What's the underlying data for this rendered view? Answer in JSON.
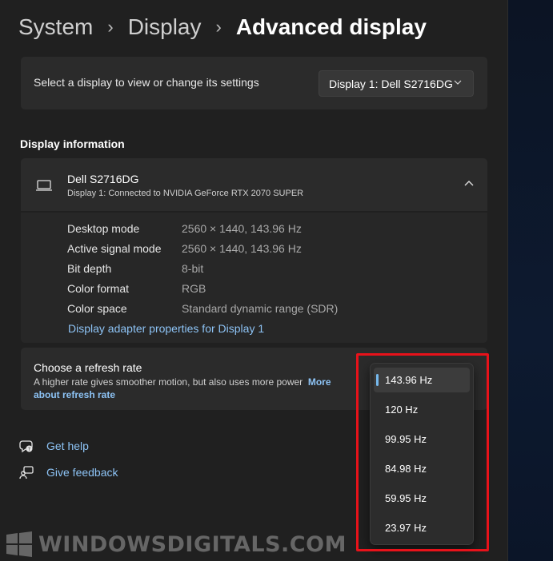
{
  "breadcrumb": {
    "items": [
      "System",
      "Display"
    ],
    "current": "Advanced display"
  },
  "display_select": {
    "label": "Select a display to view or change its settings",
    "value": "Display 1: Dell S2716DG"
  },
  "display_information": {
    "heading": "Display information",
    "monitor_name": "Dell S2716DG",
    "connection": "Display 1: Connected to NVIDIA GeForce RTX 2070 SUPER",
    "specs": [
      {
        "label": "Desktop mode",
        "value": "2560 × 1440, 143.96 Hz"
      },
      {
        "label": "Active signal mode",
        "value": "2560 × 1440, 143.96 Hz"
      },
      {
        "label": "Bit depth",
        "value": "8-bit"
      },
      {
        "label": "Color format",
        "value": "RGB"
      },
      {
        "label": "Color space",
        "value": "Standard dynamic range (SDR)"
      }
    ],
    "adapter_link": "Display adapter properties for Display 1"
  },
  "refresh_rate": {
    "title": "Choose a refresh rate",
    "description": "A higher rate gives smoother motion, but also uses more power",
    "more_link": "More about refresh rate",
    "options": [
      "143.96 Hz",
      "120 Hz",
      "99.95 Hz",
      "84.98 Hz",
      "59.95 Hz",
      "23.97 Hz"
    ],
    "selected": "143.96 Hz"
  },
  "help": {
    "get_help": "Get help",
    "give_feedback": "Give feedback"
  },
  "watermark": "WindowsDigitals.com",
  "colors": {
    "background": "#202020",
    "card": "#2b2b2b",
    "accent": "#76b9ed",
    "link": "#8dc3f5",
    "highlight": "#e8121a"
  },
  "icons": {
    "breadcrumb_separator": "chevron-right-icon",
    "dropdown": "chevron-down-icon",
    "monitor": "laptop-monitor-icon",
    "collapse": "chevron-up-icon",
    "get_help": "help-chat-icon",
    "give_feedback": "feedback-icon"
  }
}
